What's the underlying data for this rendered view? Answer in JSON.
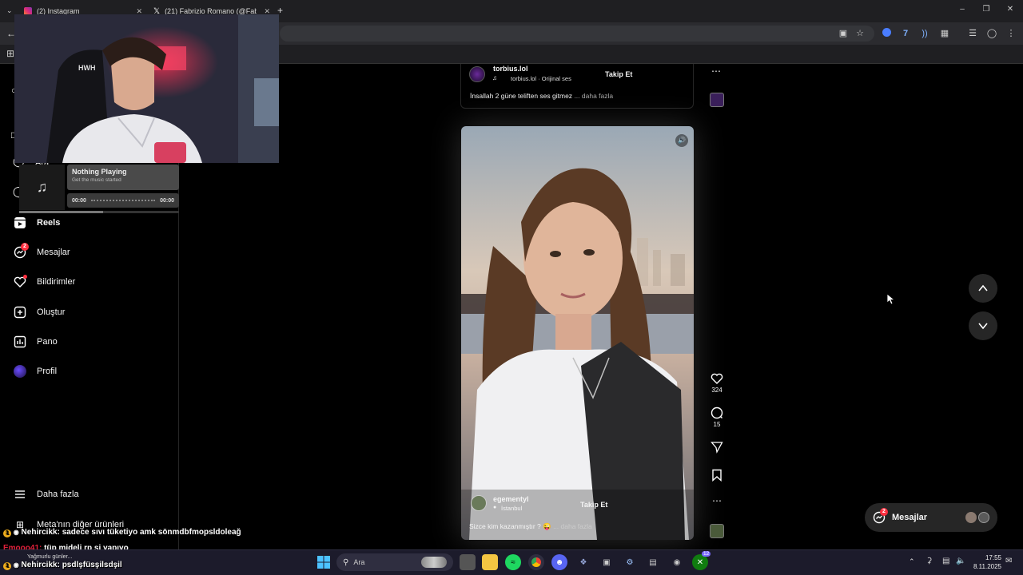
{
  "browser": {
    "tabs": [
      {
        "label": "(2) Instagram",
        "color": "#d6249f"
      },
      {
        "label": "(21) Fabrizio Romano (@Fabrizio",
        "color": "#ffffff"
      }
    ],
    "new_tab": "+",
    "minimize": "–",
    "maximize": "❐",
    "close": "✕"
  },
  "webcam": {
    "neon_text": "HWH"
  },
  "music_widget": {
    "title": "Nothing Playing",
    "subtitle": "Get the music started",
    "time_start": "00:00",
    "time_end": "00:00"
  },
  "sidebar": {
    "partial_label": "Ara",
    "items": [
      {
        "label": "Reels",
        "icon": "reels-icon",
        "bold": true
      },
      {
        "label": "Mesajlar",
        "icon": "messenger-icon",
        "badge": "2"
      },
      {
        "label": "Bildirimler",
        "icon": "heart-icon",
        "dot": true
      },
      {
        "label": "Oluştur",
        "icon": "plus-square-icon"
      },
      {
        "label": "Pano",
        "icon": "dashboard-icon"
      },
      {
        "label": "Profil",
        "icon": "avatar"
      }
    ],
    "more": "Daha fazla",
    "meta": "Meta'nın diğer ürünleri"
  },
  "post_top": {
    "username": "torbius.lol",
    "audio": "torbius.lol · Orijinal ses",
    "follow": "Takip Et",
    "caption": "İnsallah 2 güne teliften ses gitmez",
    "more": "... daha fazla"
  },
  "reel": {
    "username": "egementyl",
    "location": "İstanbul",
    "follow": "Takip Et",
    "caption": "Sizce kim kazanmıştır ? 😜",
    "more": "... daha fazla",
    "likes": "324",
    "comments": "15",
    "more_dots": "…"
  },
  "messages_pill": {
    "label": "Mesajlar",
    "badge": "2"
  },
  "chat": [
    {
      "user": "Nehircikk:",
      "text": "sadece sıvı tüketiyo amk sönmdbfmopsldoleağ"
    },
    {
      "user": "Emooo41:",
      "text": "tüp mideli rp si yapıyo"
    },
    {
      "user": "Nehircikk:",
      "text": "psdlşfüsşilsdşil"
    }
  ],
  "chat_sub": "Yağmurlu günler...",
  "taskbar": {
    "search": "Ara",
    "time": "17:55",
    "date": "8.11.2025",
    "xbox_badge": "12"
  },
  "colors": {
    "accent_red": "#ff3040",
    "brand_gradient": "#d6249f"
  }
}
